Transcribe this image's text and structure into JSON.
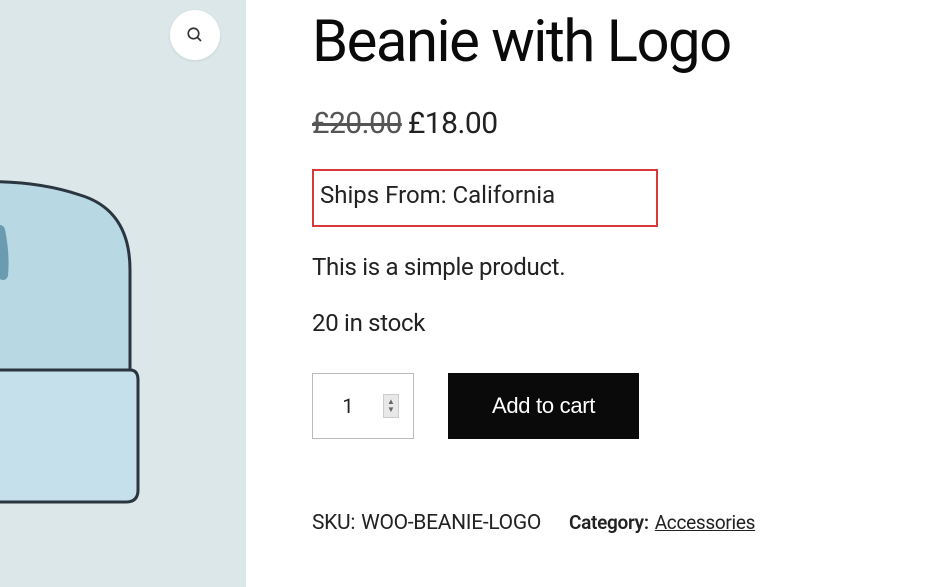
{
  "product": {
    "title": "Beanie with Logo",
    "price_original": "£20.00",
    "price_sale": "£18.00",
    "ships_from_label": "Ships From: ",
    "ships_from_value": "California",
    "description": "This is a simple product.",
    "stock": "20 in stock",
    "quantity": "1",
    "add_to_cart_label": "Add to cart",
    "sku_label": "SKU: ",
    "sku_value": "WOO-BEANIE-LOGO",
    "category_label": "Category: ",
    "category_value": "Accessories"
  }
}
